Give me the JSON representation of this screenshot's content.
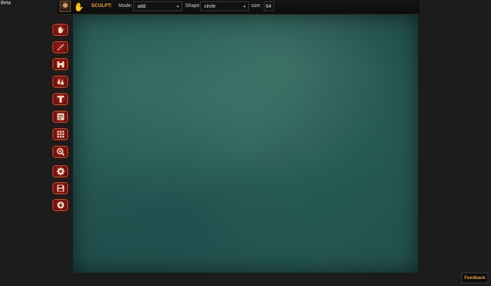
{
  "app": {
    "badge": "Beta"
  },
  "toolbar": {
    "tool_label": "SCULPT:",
    "mode_label": "Mode:",
    "mode_value": "add",
    "shape_label": "Shape:",
    "shape_value": "circle",
    "size_label": "size:",
    "size_value": "64"
  },
  "sidebar": {
    "tools": [
      {
        "name": "sculpt",
        "icon": "hand-icon"
      },
      {
        "name": "paint",
        "icon": "brush-icon"
      },
      {
        "name": "structures",
        "icon": "castle-icon"
      },
      {
        "name": "trees",
        "icon": "trees-icon"
      },
      {
        "name": "text",
        "icon": "text-icon"
      },
      {
        "name": "notes",
        "icon": "document-icon"
      },
      {
        "name": "grid",
        "icon": "grid-icon"
      },
      {
        "name": "zoom",
        "icon": "zoom-icon"
      },
      {
        "name": "settings",
        "icon": "gear-icon"
      },
      {
        "name": "save",
        "icon": "save-icon"
      },
      {
        "name": "export",
        "icon": "download-icon"
      }
    ]
  },
  "footer": {
    "feedback_label": "Feedback"
  },
  "colors": {
    "accent": "#e8a23a",
    "button": "#8a1414",
    "map": "#2f6360"
  }
}
